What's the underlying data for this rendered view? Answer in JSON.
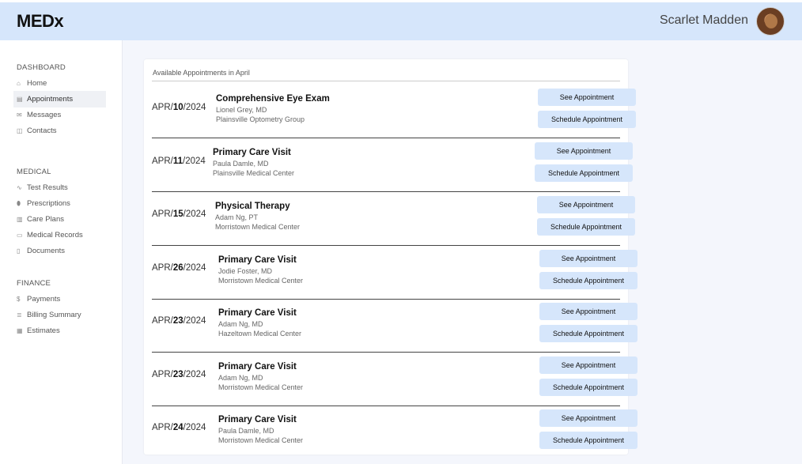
{
  "header": {
    "logo": "MEDx",
    "user_name": "Scarlet Madden"
  },
  "sidebar": {
    "sections": [
      {
        "title": "DASHBOARD",
        "items": [
          {
            "label": "Home",
            "icon": "home-icon",
            "glyph": "⌂"
          },
          {
            "label": "Appointments",
            "icon": "calendar-icon",
            "glyph": "▤",
            "active": true
          },
          {
            "label": "Messages",
            "icon": "mail-icon",
            "glyph": "✉"
          },
          {
            "label": "Contacts",
            "icon": "contacts-icon",
            "glyph": "◫"
          }
        ]
      },
      {
        "title": "MEDICAL",
        "items": [
          {
            "label": "Test Results",
            "icon": "pulse-icon",
            "glyph": "∿"
          },
          {
            "label": "Prescriptions",
            "icon": "pill-icon",
            "glyph": "⬮"
          },
          {
            "label": "Care Plans",
            "icon": "clipboard-icon",
            "glyph": "▥"
          },
          {
            "label": "Medical Records",
            "icon": "folder-icon",
            "glyph": "▭"
          },
          {
            "label": "Documents",
            "icon": "document-icon",
            "glyph": "▯"
          }
        ]
      },
      {
        "title": "FINANCE",
        "items": [
          {
            "label": "Payments",
            "icon": "dollar-icon",
            "glyph": "$"
          },
          {
            "label": "Billing Summary",
            "icon": "list-icon",
            "glyph": "≣"
          },
          {
            "label": "Estimates",
            "icon": "calculator-icon",
            "glyph": "▦"
          }
        ]
      }
    ]
  },
  "main": {
    "title": "Available Appointments in April",
    "see_label": "See Appointment",
    "schedule_label": "Schedule Appointment",
    "appointments": [
      {
        "month": "APR/",
        "day": "10",
        "year": "/2024",
        "title": "Comprehensive Eye Exam",
        "doctor": "Lionel Grey, MD",
        "location": "Plainsville Optometry Group"
      },
      {
        "month": "APR/",
        "day": "11",
        "year": "/2024",
        "title": "Primary Care Visit",
        "doctor": "Paula Damle, MD",
        "location": "Plainsville Medical Center"
      },
      {
        "month": "APR/",
        "day": "15",
        "year": "/2024",
        "title": "Physical Therapy",
        "doctor": "Adam Ng, PT",
        "location": "Morristown Medical Center"
      },
      {
        "month": "APR/",
        "day": "26",
        "year": "/2024",
        "title": "Primary Care Visit",
        "doctor": "Jodie Foster, MD",
        "location": "Morristown Medical Center"
      },
      {
        "month": "APR/",
        "day": "23",
        "year": "/2024",
        "title": "Primary Care Visit",
        "doctor": "Adam Ng, MD",
        "location": "Hazeltown Medical Center"
      },
      {
        "month": "APR/",
        "day": "23",
        "year": "/2024",
        "title": "Primary Care Visit",
        "doctor": "Adam Ng, MD",
        "location": "Morristown Medical Center"
      },
      {
        "month": "APR/",
        "day": "24",
        "year": "/2024",
        "title": "Primary Care Visit",
        "doctor": "Paula Damle, MD",
        "location": "Morristown Medical Center"
      }
    ]
  }
}
